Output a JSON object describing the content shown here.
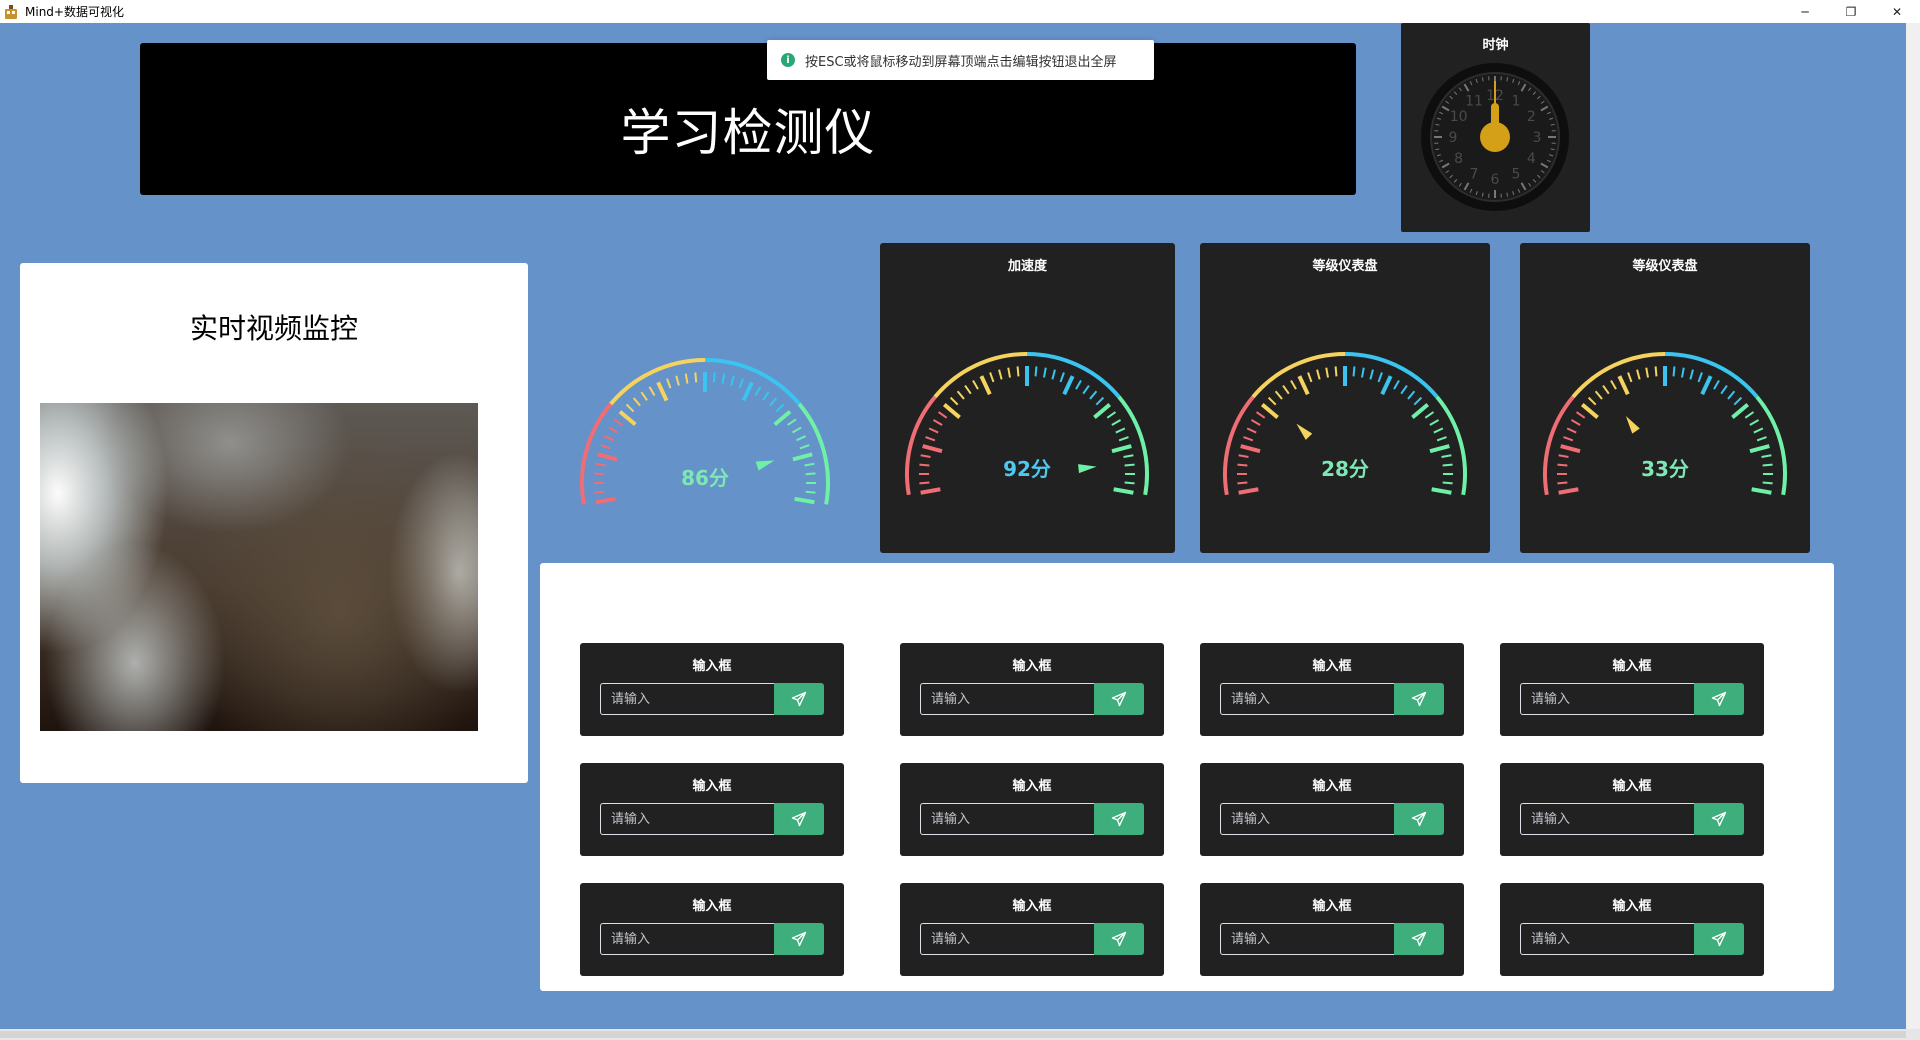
{
  "window": {
    "title": "Mind+数据可视化",
    "controls": {
      "minimize": "─",
      "restore": "❐",
      "close": "✕"
    }
  },
  "toast": {
    "text": "按ESC或将鼠标移动到屏幕顶端点击编辑按钮退出全屏",
    "icon": "info-icon"
  },
  "header": {
    "title": "学习检测仪"
  },
  "clock": {
    "title": "时钟",
    "hour_numerals": [
      "12",
      "1",
      "2",
      "3",
      "4",
      "5",
      "6",
      "7",
      "8",
      "9",
      "10",
      "11"
    ],
    "colors": {
      "hands": "#d4a017",
      "face": "#1a1a1a"
    }
  },
  "video": {
    "title": "实时视频监控"
  },
  "gauges": [
    {
      "title": "",
      "value": 86,
      "unit": "分",
      "min": 0,
      "max": 100,
      "label_color": "#7ee8b5"
    },
    {
      "title": "加速度",
      "value": 92,
      "unit": "分",
      "min": 0,
      "max": 100,
      "label_color": "#4dc9f0"
    },
    {
      "title": "等级仪表盘",
      "value": 28,
      "unit": "分",
      "min": 0,
      "max": 100,
      "label_color": "#7ee8b5"
    },
    {
      "title": "等级仪表盘",
      "value": 33,
      "unit": "分",
      "min": 0,
      "max": 100,
      "label_color": "#7ee8b5"
    }
  ],
  "gauge_colors": {
    "low": "#f06d74",
    "mid_low": "#f5d35e",
    "mid_high": "#3ac4ef",
    "high": "#6ef0a7"
  },
  "input_cards": [
    {
      "title": "输入框",
      "placeholder": "请输入"
    },
    {
      "title": "输入框",
      "placeholder": "请输入"
    },
    {
      "title": "输入框",
      "placeholder": "请输入"
    },
    {
      "title": "输入框",
      "placeholder": "请输入"
    },
    {
      "title": "输入框",
      "placeholder": "请输入"
    },
    {
      "title": "输入框",
      "placeholder": "请输入"
    },
    {
      "title": "输入框",
      "placeholder": "请输入"
    },
    {
      "title": "输入框",
      "placeholder": "请输入"
    },
    {
      "title": "输入框",
      "placeholder": "请输入"
    },
    {
      "title": "输入框",
      "placeholder": "请输入"
    },
    {
      "title": "输入框",
      "placeholder": "请输入"
    },
    {
      "title": "输入框",
      "placeholder": "请输入"
    }
  ],
  "colors": {
    "background": "#6492c9",
    "panel": "#212121",
    "send_button": "#3eaf7c"
  }
}
